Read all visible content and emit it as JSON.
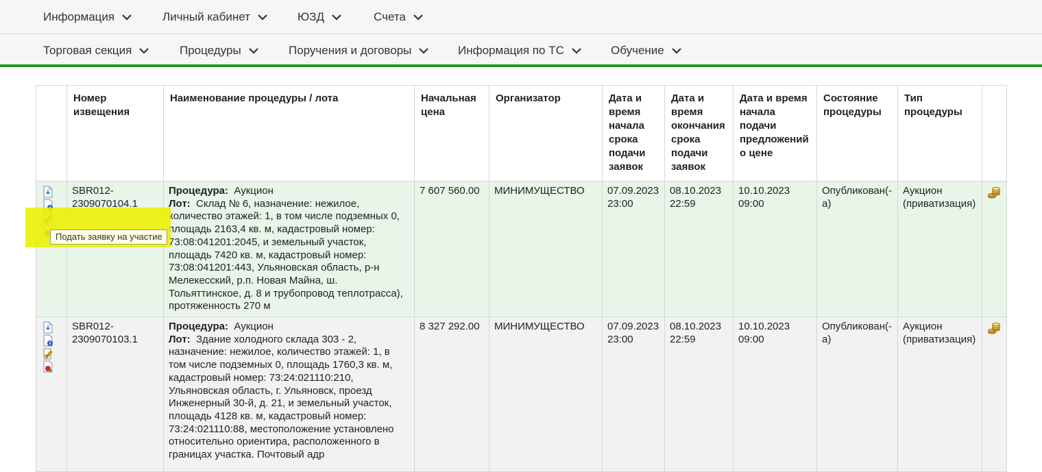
{
  "nav_primary": [
    {
      "label": "Информация"
    },
    {
      "label": "Личный кабинет"
    },
    {
      "label": "ЮЗД"
    },
    {
      "label": "Счета"
    }
  ],
  "nav_secondary": [
    {
      "label": "Торговая секция"
    },
    {
      "label": "Процедуры"
    },
    {
      "label": "Поручения и договоры"
    },
    {
      "label": "Информация по ТС"
    },
    {
      "label": "Обучение"
    }
  ],
  "table": {
    "headers": {
      "number": "Номер извещения",
      "name": "Наименование процедуры / лота",
      "price": "Начальная цена",
      "organizer": "Организатор",
      "start": "Дата и время начала срока подачи заявок",
      "end": "Дата и время окончания срока подачи заявок",
      "bids": "Дата и время начала подачи предложений о цене",
      "status": "Состояние процедуры",
      "type": "Тип процедуры"
    },
    "labels": {
      "procedure": "Процедура:",
      "lot": "Лот:"
    },
    "rows": [
      {
        "number": "SBR012-2309070104.1",
        "procedure": "Аукцион",
        "lot": "Склад № 6, назначение: нежилое, количество этажей: 1, в том числе подземных 0, площадь 2163,4 кв. м, кадастровый номер: 73:08:041201:2045, и земельный участок, площадь 7420 кв. м, кадастровый номер: 73:08:041201:443, Ульяновская область, р-н Мелекесский, р.п. Новая Майна, ш. Тольяттинское, д. 8 и трубопровод теплотрасса), протяженность 270 м",
        "price": "7 607 560.00",
        "organizer": "МИНИМУЩЕСТВО",
        "start": "07.09.2023 23:00",
        "end": "08.10.2023 22:59",
        "bids": "10.10.2023 09:00",
        "status": "Опубликован(-а)",
        "type": "Аукцион (приватизация)"
      },
      {
        "number": "SBR012-2309070103.1",
        "procedure": "Аукцион",
        "lot": "Здание холодного склада 303 - 2, назначение: нежилое, количество этажей: 1, в том числе подземных 0, площадь 1760,3 кв. м, кадастровый номер: 73:24:021110:210, Ульяновская область, г. Ульяновск, проезд Инженерный 30-й, д. 21, и земельный участок, площадь 4128 кв. м, кадастровый номер: 73:24:021110:88, местоположение установлено относительно ориентира, расположенного в границах участка. Почтовый адр",
        "price": "8 327 292.00",
        "organizer": "МИНИМУЩЕСТВО",
        "start": "07.09.2023 23:00",
        "end": "08.10.2023 22:59",
        "bids": "10.10.2023 09:00",
        "status": "Опубликован(-а)",
        "type": "Аукцион (приватизация)"
      }
    ]
  },
  "tooltip": {
    "text": "Подать заявку на участие"
  },
  "colors": {
    "accent_green": "#1b9c1b",
    "row_highlight": "#e8f5e8",
    "row_default": "#f2f2f2",
    "annotation_yellow": "#ebf000"
  }
}
